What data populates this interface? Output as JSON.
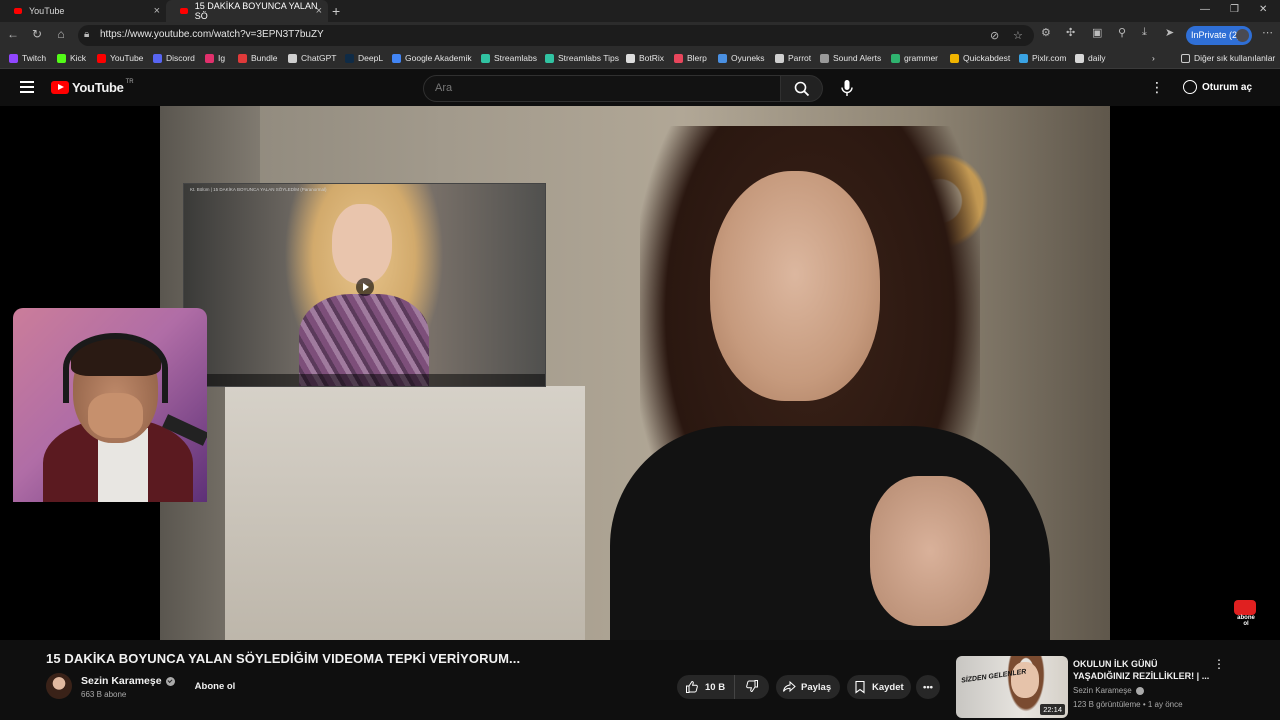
{
  "browser": {
    "tabs": [
      {
        "label": "YouTube"
      },
      {
        "label": "15 DAKİKA BOYUNCA YALAN SÖ"
      }
    ],
    "url": "https://www.youtube.com/watch?v=3EPN3T7buZY",
    "inprivate_label": "InPrivate (2)",
    "bookmarks": [
      {
        "label": "Twitch",
        "color": "#9146ff"
      },
      {
        "label": "Kick",
        "color": "#53fc18"
      },
      {
        "label": "YouTube",
        "color": "#ff0000"
      },
      {
        "label": "Discord",
        "color": "#5865f2"
      },
      {
        "label": "Ig",
        "color": "#e1306c"
      },
      {
        "label": "Bundle",
        "color": "#e03a3a"
      },
      {
        "label": "ChatGPT",
        "color": "#cfcfcf"
      },
      {
        "label": "DeepL",
        "color": "#0f2b46"
      },
      {
        "label": "Google Akademik",
        "color": "#4285f4"
      },
      {
        "label": "Streamlabs",
        "color": "#31c3a2"
      },
      {
        "label": "Streamlabs Tips",
        "color": "#31c3a2"
      },
      {
        "label": "BotRix",
        "color": "#dddddd"
      },
      {
        "label": "Blerp",
        "color": "#e8465c"
      },
      {
        "label": "Oyuneks",
        "color": "#4a90e2"
      },
      {
        "label": "Parrot",
        "color": "#d0d0d0"
      },
      {
        "label": "Sound Alerts",
        "color": "#9a9a9a"
      },
      {
        "label": "grammer",
        "color": "#2fb36f"
      },
      {
        "label": "Quickabdest",
        "color": "#f0b400"
      },
      {
        "label": "Pixlr.com",
        "color": "#3aa3e3"
      },
      {
        "label": "daily",
        "color": "#d8d8d8"
      }
    ],
    "other_bookmarks": "Diğer sık kullanılanlar"
  },
  "youtube": {
    "logo_text": "YouTube",
    "country_code": "TR",
    "search_placeholder": "Ara",
    "signin_label": "Oturum aç",
    "accent": "#ff0000"
  },
  "player": {
    "inset_caption": "Kt. Bölüm | 15 DAKİKA BOYUNCA YALAN SÖYLEDİM (Paranormal)",
    "watermark_text": "abone ol"
  },
  "video": {
    "title": "15 DAKİKA BOYUNCA YALAN SÖYLEDİĞİM VIDEOMA TEPKİ VERİYORUM...",
    "channel": "Sezin Karameşe",
    "subscribers": "663 B abone",
    "subscribe_label": "Abone ol",
    "likes": "10 B",
    "share_label": "Paylaş",
    "save_label": "Kaydet"
  },
  "recommendation": {
    "title": "OKULUN İLK GÜNÜ YAŞADIĞINIZ REZİLLİKLER! | ...",
    "channel": "Sezin Karameşe",
    "meta": "123 B görüntüleme • 1 ay önce",
    "duration": "22:14",
    "thumb_text": "SİZDEN GELENLER"
  }
}
